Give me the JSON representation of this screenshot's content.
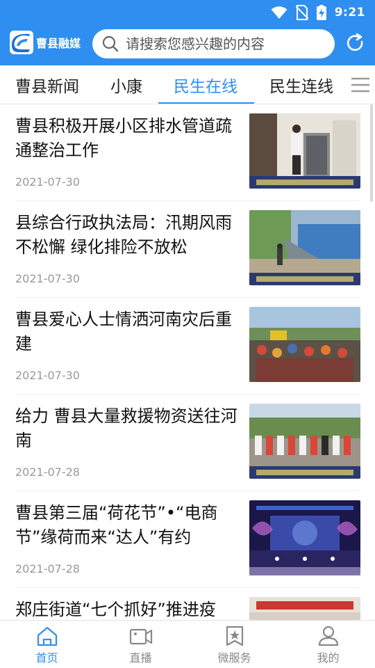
{
  "status_bar": {
    "time": "9:21"
  },
  "app": {
    "logo_text": "曹县融媒"
  },
  "search": {
    "placeholder": "请搜索您感兴趣的内容"
  },
  "tabs": [
    {
      "label": "曹县新闻",
      "active": false
    },
    {
      "label": "小康",
      "active": false
    },
    {
      "label": "民生在线",
      "active": true
    },
    {
      "label": "民生连线",
      "active": false
    }
  ],
  "articles": [
    {
      "title": "曹县积极开展小区排水管道疏通整治工作",
      "date": "2021-07-30"
    },
    {
      "title": "县综合行政执法局：汛期风雨不松懈 绿化排险不放松",
      "date": "2021-07-30"
    },
    {
      "title": "曹县爱心人士情洒河南灾后重建",
      "date": "2021-07-30"
    },
    {
      "title": "给力 曹县大量救援物资送往河南",
      "date": "2021-07-28"
    },
    {
      "title": "曹县第三届“荷花节”•“电商节”缘荷而来“达人”有约",
      "date": "2021-07-28"
    },
    {
      "title": "郑庄街道“七个抓好”推进疫",
      "date": ""
    }
  ],
  "bottom_nav": [
    {
      "label": "首页",
      "icon": "home-icon",
      "active": true
    },
    {
      "label": "直播",
      "icon": "video-icon",
      "active": false
    },
    {
      "label": "微服务",
      "icon": "star-bookmark-icon",
      "active": false
    },
    {
      "label": "我的",
      "icon": "user-icon",
      "active": false
    }
  ],
  "colors": {
    "primary": "#2f8ff0",
    "text": "#111111",
    "date": "#999999"
  }
}
